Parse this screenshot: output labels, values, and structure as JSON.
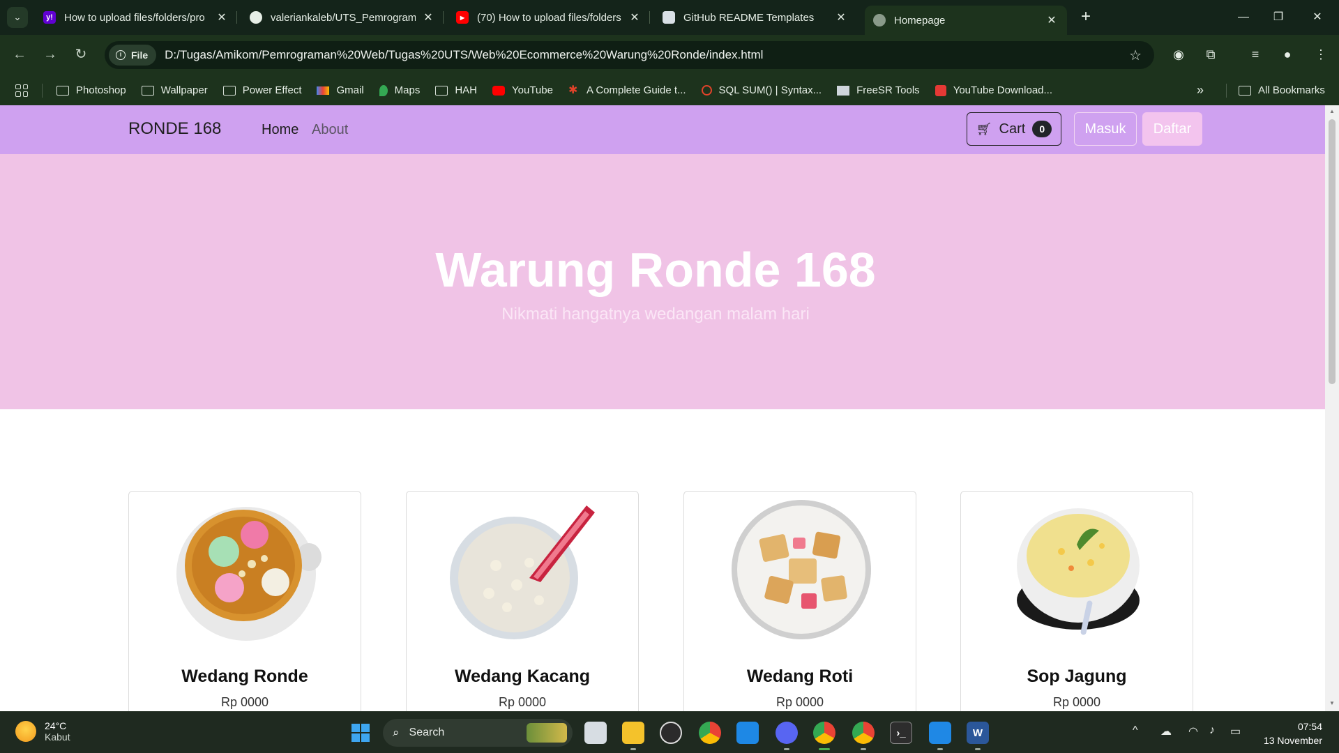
{
  "browser": {
    "tabs": [
      {
        "title": "How to upload files/folders/pro",
        "favicon": "yahoo-icon",
        "color": "#6001d2",
        "glyph": "y!"
      },
      {
        "title": "valeriankaleb/UTS_Pemrograma",
        "favicon": "github-icon",
        "color": "#e6eee6",
        "glyph": "●"
      },
      {
        "title": "(70) How to upload files/folders",
        "favicon": "youtube-icon",
        "color": "#ff0000",
        "glyph": "▶"
      },
      {
        "title": "GitHub README Templates",
        "favicon": "readme-icon",
        "color": "#d9e0e6",
        "glyph": "▢"
      },
      {
        "title": "Homepage",
        "favicon": "globe-icon",
        "color": "#8a9a8a",
        "glyph": "◍"
      }
    ],
    "address": {
      "chip": "File",
      "url": "D:/Tugas/Amikom/Pemrograman%20Web/Tugas%20UTS/Web%20Ecommerce%20Warung%20Ronde/index.html"
    },
    "bookmarks": [
      {
        "label": "Photoshop",
        "icon": "folder"
      },
      {
        "label": "Wallpaper",
        "icon": "folder"
      },
      {
        "label": "Power Effect",
        "icon": "folder"
      },
      {
        "label": "Gmail",
        "icon": "gmail"
      },
      {
        "label": "Maps",
        "icon": "maps"
      },
      {
        "label": "HAH",
        "icon": "folder"
      },
      {
        "label": "YouTube",
        "icon": "youtube"
      },
      {
        "label": "A Complete Guide t...",
        "icon": "star"
      },
      {
        "label": "SQL SUM() | Syntax...",
        "icon": "sql"
      },
      {
        "label": "FreeSR Tools",
        "icon": "freesr"
      },
      {
        "label": "YouTube Download...",
        "icon": "download"
      }
    ],
    "all_bookmarks": "All Bookmarks"
  },
  "site": {
    "brand": "RONDE 168",
    "nav": [
      {
        "label": "Home"
      },
      {
        "label": "About"
      }
    ],
    "cart_label": "Cart",
    "cart_count": "0",
    "login": "Masuk",
    "register": "Daftar",
    "hero_title": "Warung Ronde 168",
    "hero_subtitle": "Nikmati hangatnya wedangan malam hari",
    "products": [
      {
        "name": "Wedang Ronde",
        "price": "Rp 0000"
      },
      {
        "name": "Wedang Kacang",
        "price": "Rp 0000"
      },
      {
        "name": "Wedang Roti",
        "price": "Rp 0000"
      },
      {
        "name": "Sop Jagung",
        "price": "Rp 0000"
      }
    ],
    "colors": {
      "nav": "#cfa1f0",
      "hero": "#f0c3e6"
    }
  },
  "taskbar": {
    "weather_temp": "24°C",
    "weather_cond": "Kabut",
    "search": "Search",
    "time": "07:54",
    "date": "13 November"
  }
}
